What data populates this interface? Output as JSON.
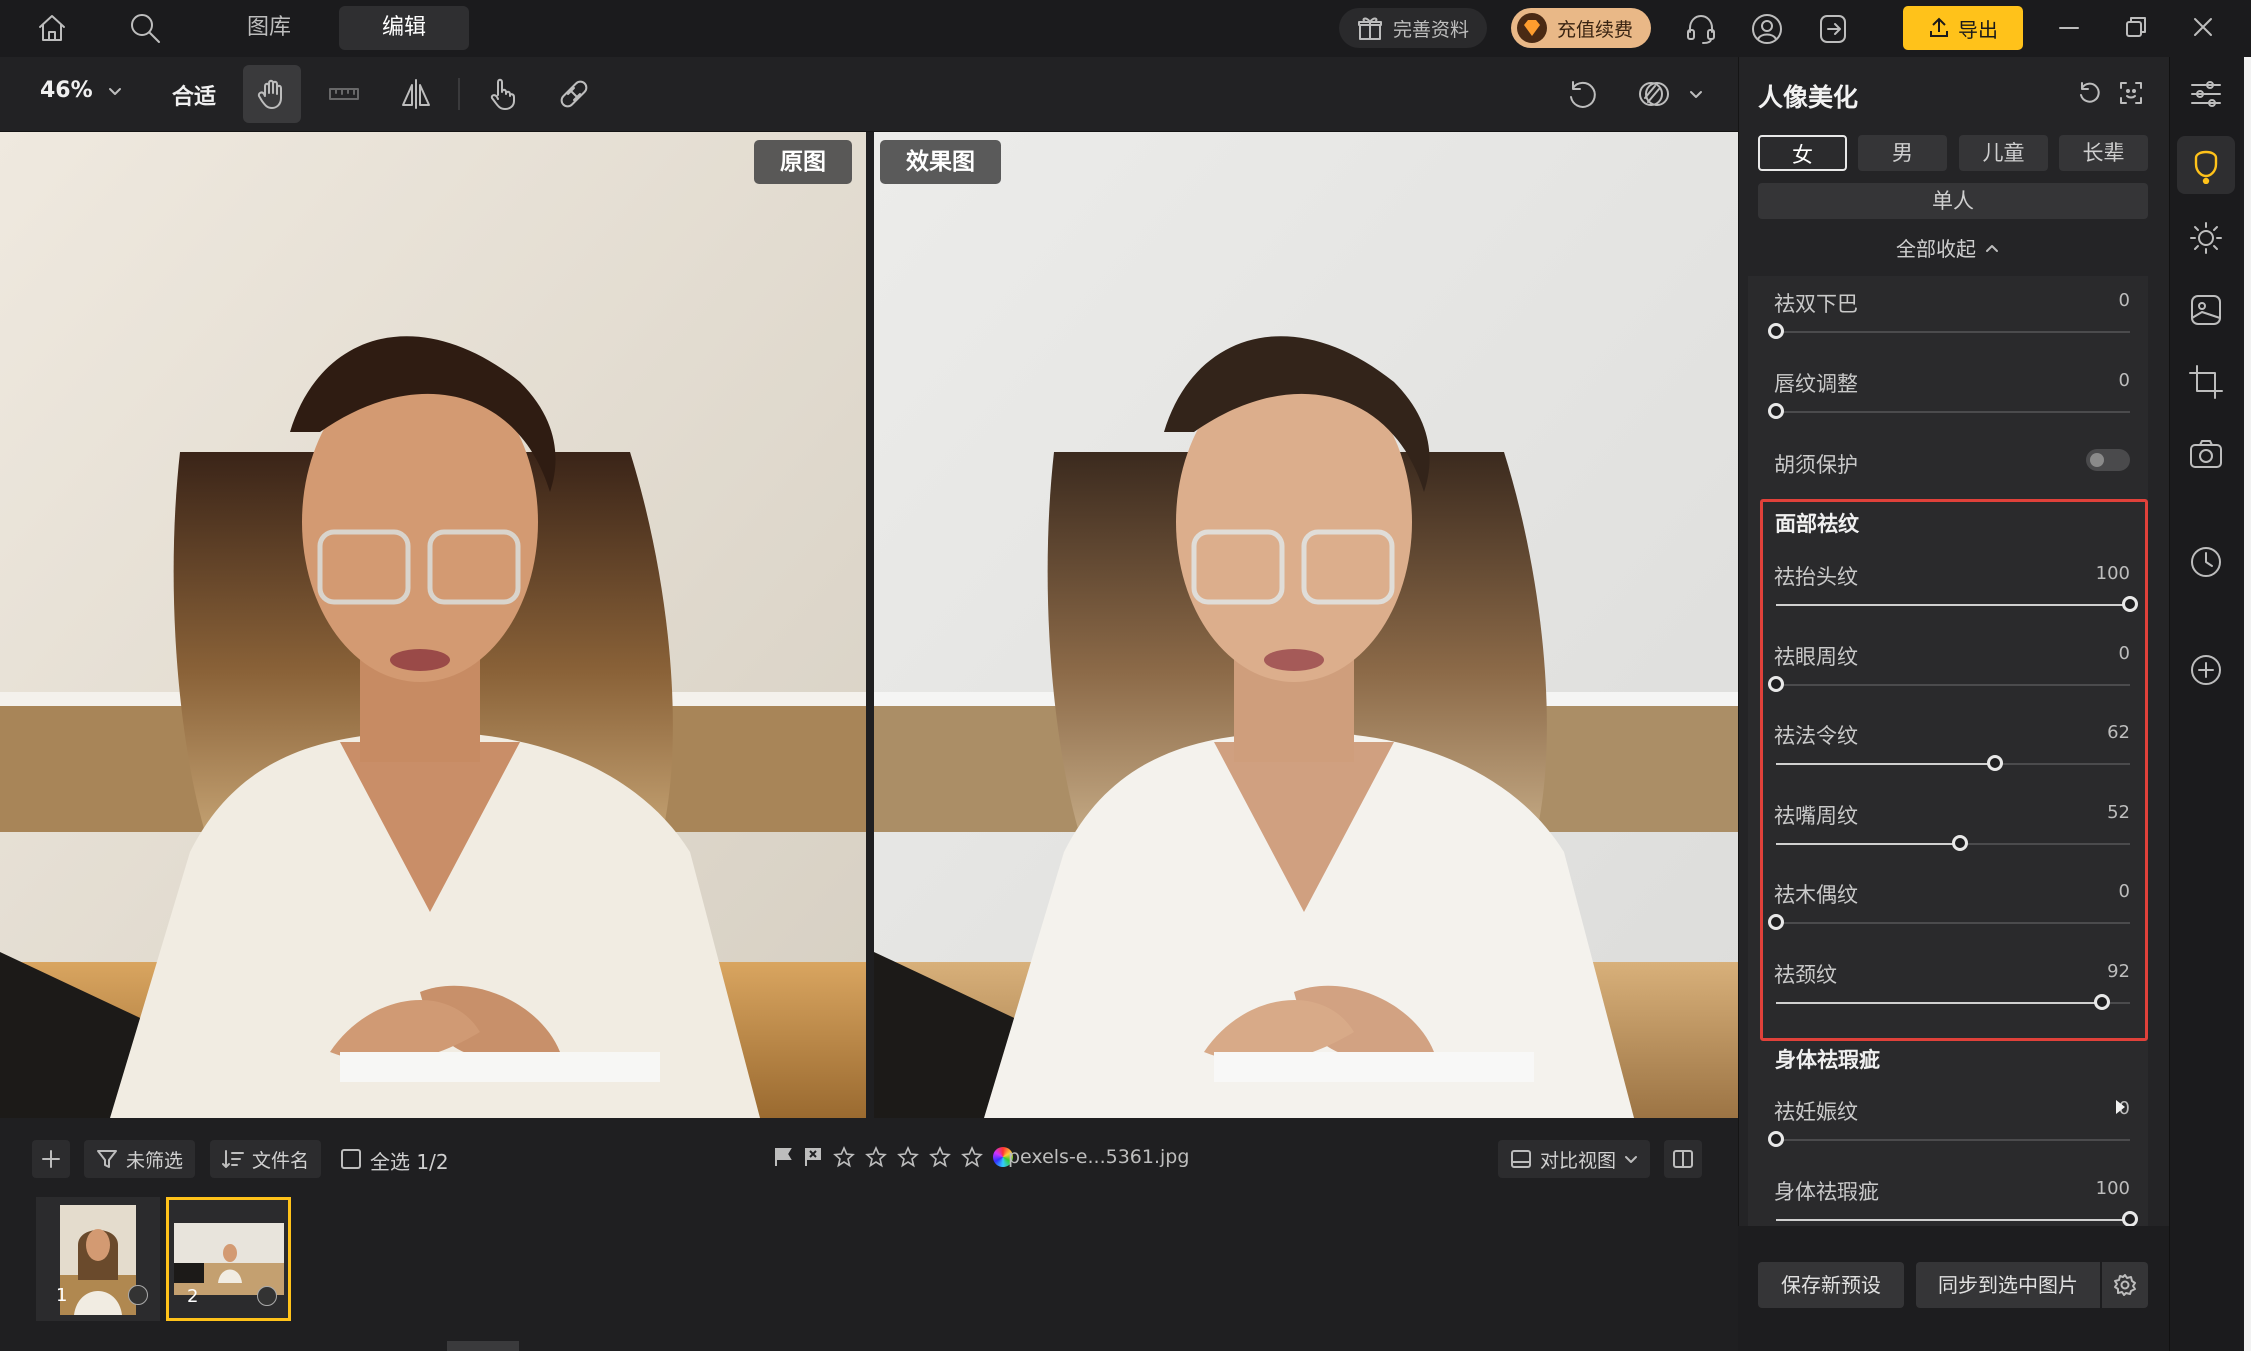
{
  "topbar": {
    "tabs": [
      {
        "label": "图库"
      },
      {
        "label": "编辑"
      }
    ],
    "profile_label": "完善资料",
    "vip_label": "充值续费",
    "export_label": "导出"
  },
  "toolbar": {
    "zoom": "46%",
    "fit_label": "合适"
  },
  "canvas": {
    "original_label": "原图",
    "result_label": "效果图"
  },
  "filmstrip": {
    "filter_label": "未筛选",
    "sort_label": "文件名",
    "select_all_label": "全选 1/2",
    "filename": "pexels-e...5361.jpg",
    "compare_label": "对比视图",
    "thumbs": [
      {
        "num": "1"
      },
      {
        "num": "2"
      }
    ]
  },
  "panel": {
    "title": "人像美化",
    "genders": [
      {
        "label": "女"
      },
      {
        "label": "男"
      },
      {
        "label": "儿童"
      },
      {
        "label": "长辈"
      }
    ],
    "mode_label": "单人",
    "collapse_label": "全部收起",
    "sliders_top": [
      {
        "label": "祛双下巴",
        "value": "0",
        "level": 0
      },
      {
        "label": "唇纹调整",
        "value": "0",
        "level": 0
      }
    ],
    "beard_label": "胡须保护",
    "face_section_title": "面部祛纹",
    "face_sliders": [
      {
        "label": "祛抬头纹",
        "value": "100",
        "level": 100
      },
      {
        "label": "祛眼周纹",
        "value": "0",
        "level": 0
      },
      {
        "label": "祛法令纹",
        "value": "62",
        "level": 62
      },
      {
        "label": "祛嘴周纹",
        "value": "52",
        "level": 52
      },
      {
        "label": "祛木偶纹",
        "value": "0",
        "level": 0
      },
      {
        "label": "祛颈纹",
        "value": "92",
        "level": 92
      }
    ],
    "body_section_title": "身体祛瑕疵",
    "body_sliders": [
      {
        "label": "祛妊娠纹",
        "value": "0",
        "level": 0
      },
      {
        "label": "身体祛瑕疵",
        "value": "100",
        "level": 100
      }
    ],
    "save_preset_label": "保存新预设",
    "sync_label": "同步到选中图片"
  },
  "colors": {
    "accent_yellow": "#ffc21a",
    "highlight_red": "#e0413a"
  }
}
